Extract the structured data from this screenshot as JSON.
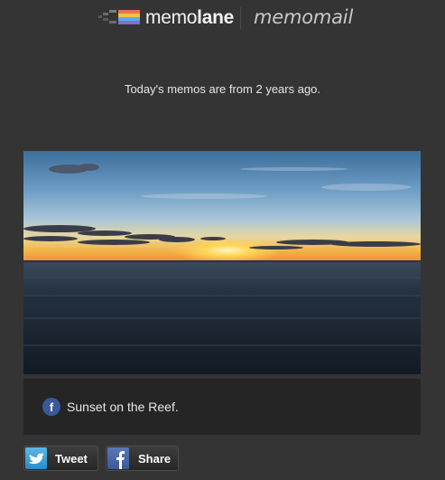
{
  "header": {
    "brand_prefix": "memo",
    "brand_suffix": "lane",
    "product": "memomail"
  },
  "headline": "Today's memos are from 2 years ago.",
  "memo": {
    "source_icon": "facebook-icon",
    "caption": "Sunset on the Reef."
  },
  "share": {
    "tweet_label": "Tweet",
    "tweet_icon": "twitter-bird-icon",
    "share_label": "Share",
    "share_icon": "facebook-icon"
  },
  "colors": {
    "background": "#343434",
    "caption_bar": "#252525",
    "facebook_blue": "#3b5998",
    "twitter_blue": "#2a8bc6"
  }
}
